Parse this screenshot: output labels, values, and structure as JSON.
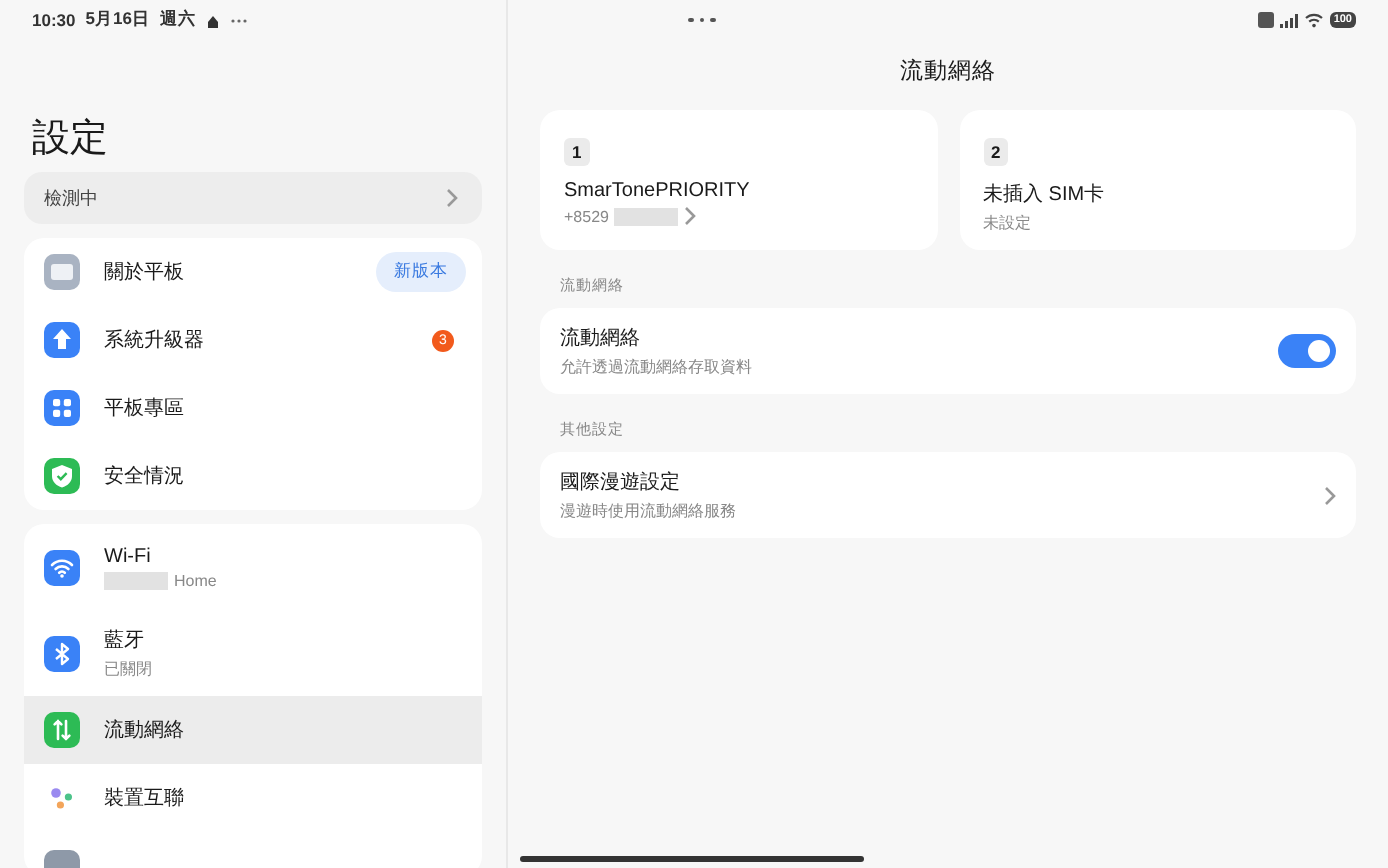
{
  "status_bar": {
    "time": "10:30",
    "date": "5月16日",
    "weekday": "週六",
    "battery": "100"
  },
  "sidebar": {
    "title": "設定",
    "update_row": {
      "label": "檢測中"
    },
    "groups": [
      {
        "items": [
          {
            "kind": "tablet",
            "label": "關於平板",
            "badge": "新版本",
            "selected": false
          },
          {
            "kind": "upgrade",
            "label": "系統升級器",
            "count": "3",
            "selected": false
          },
          {
            "kind": "grid",
            "label": "平板專區",
            "selected": false
          },
          {
            "kind": "shield",
            "label": "安全情況",
            "selected": false
          }
        ]
      },
      {
        "items": [
          {
            "kind": "wifi",
            "label": "Wi-Fi",
            "subtitle": "Home",
            "redacted": true,
            "selected": false
          },
          {
            "kind": "bluetooth",
            "label": "藍牙",
            "subtitle": "已關閉",
            "selected": false
          },
          {
            "kind": "mobile",
            "label": "流動網絡",
            "selected": true
          },
          {
            "kind": "connect",
            "label": "裝置互聯",
            "selected": false
          }
        ]
      }
    ]
  },
  "main": {
    "title": "流動網絡",
    "sim_cards": [
      {
        "slot": "1",
        "name": "SmarTonePRIORITY",
        "number": "+8529",
        "redacted": true
      },
      {
        "slot": "2",
        "name": "未插入 SIM卡",
        "status": "未設定"
      }
    ],
    "sections": [
      {
        "heading": "流動網絡",
        "rows": [
          {
            "kind": "toggle",
            "title": "流動網絡",
            "subtitle": "允許透過流動網絡存取資料",
            "on": true
          }
        ]
      },
      {
        "heading": "其他設定",
        "rows": [
          {
            "kind": "link",
            "title": "國際漫遊設定",
            "subtitle": "漫遊時使用流動網絡服務"
          }
        ]
      }
    ]
  }
}
